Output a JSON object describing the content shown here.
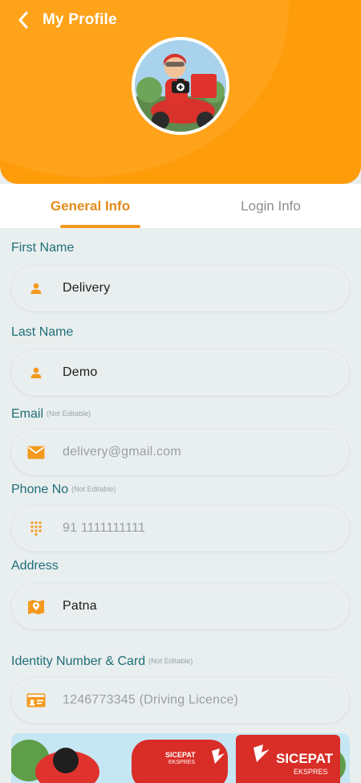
{
  "header": {
    "title": "My Profile"
  },
  "tabs": [
    {
      "label": "General Info",
      "active": true
    },
    {
      "label": "Login Info",
      "active": false
    }
  ],
  "fields": {
    "first_name": {
      "label": "First Name",
      "value": "Delivery"
    },
    "last_name": {
      "label": "Last Name",
      "value": "Demo"
    },
    "email": {
      "label": "Email",
      "note": "(Not Editable)",
      "value": "delivery@gmail.com"
    },
    "phone": {
      "label": "Phone No",
      "note": "(Not Editable)",
      "value": "91 1111111111"
    },
    "address": {
      "label": "Address",
      "value": "Patna"
    },
    "identity": {
      "label": "Identity Number & Card",
      "note": "(Not Editable)",
      "value": "1246773345 (Driving Licence)"
    }
  },
  "banner": {
    "brand": "SICEPAT",
    "brand_sub": "EKSPRES"
  },
  "colors": {
    "header": "#ff9c0a",
    "accent": "#f39a1e",
    "label": "#1f6f78",
    "icon": "#f39a1e"
  }
}
